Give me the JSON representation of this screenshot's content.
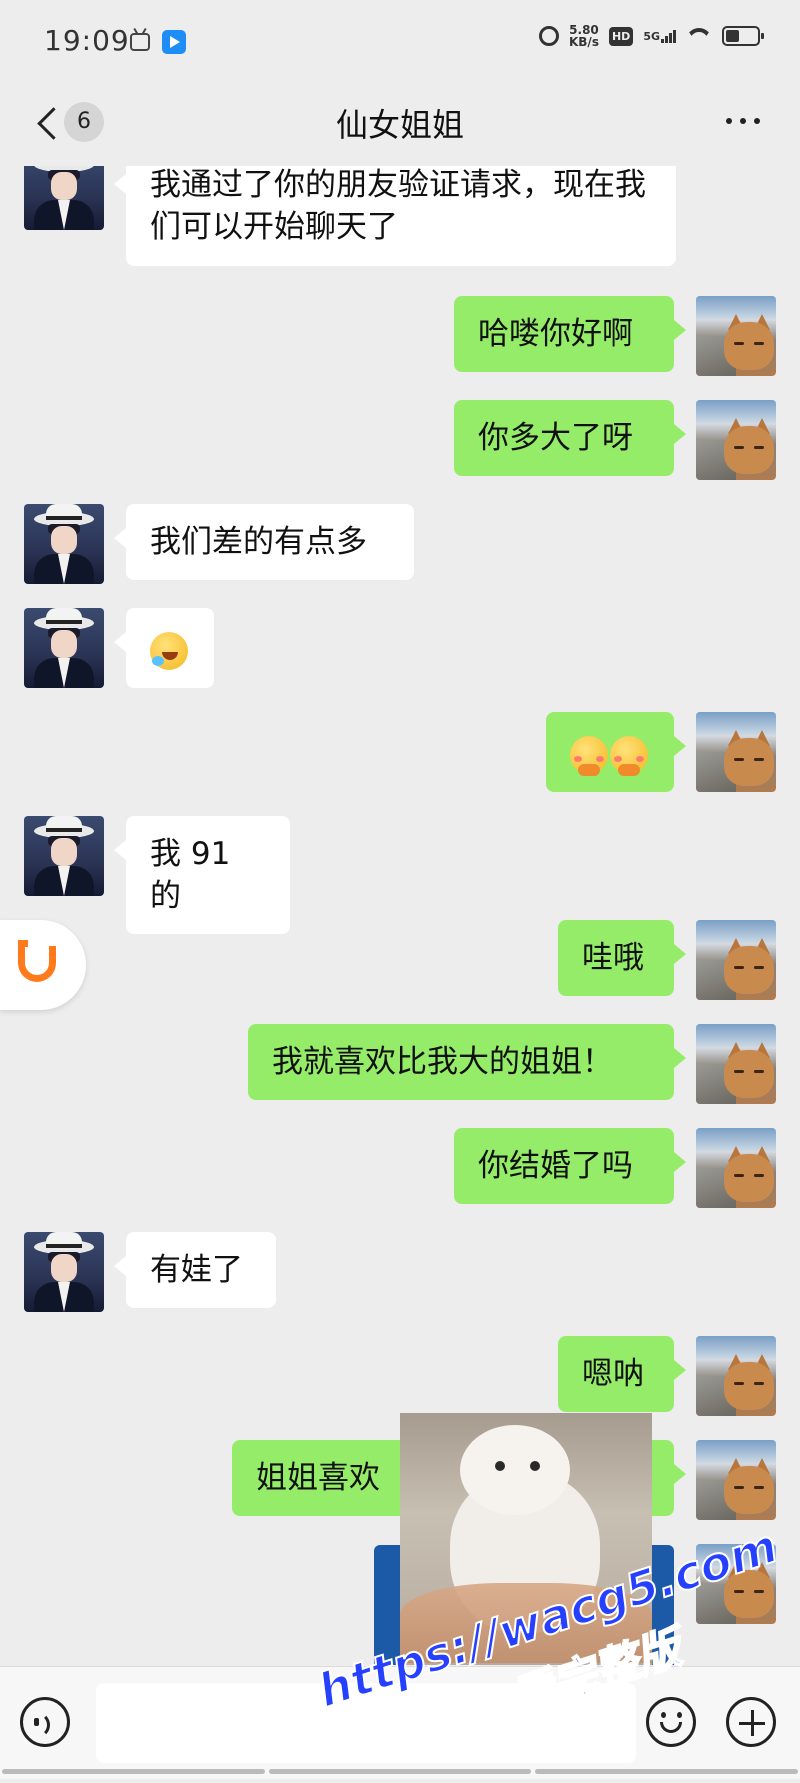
{
  "status_bar": {
    "time": "19:09",
    "speed_value": "5.80",
    "speed_unit": "KB/s",
    "hd_label": "HD",
    "network_label": "5G"
  },
  "nav": {
    "unread_count": "6",
    "title": "仙女姐姐"
  },
  "messages": [
    {
      "side": "left",
      "text": "我通过了你的朋友验证请求，现在我们可以开始聊天了"
    },
    {
      "side": "right",
      "text": "哈喽你好啊"
    },
    {
      "side": "right",
      "text": "你多大了呀"
    },
    {
      "side": "left",
      "text": "我们差的有点多"
    },
    {
      "side": "left",
      "emoji": "crying-laughing-emoji"
    },
    {
      "side": "right",
      "emoji": "blushing-emoji x2"
    },
    {
      "side": "left",
      "text": "我 91 的"
    },
    {
      "side": "right",
      "text": "哇哦"
    },
    {
      "side": "right",
      "text": "我就喜欢比我大的姐姐！"
    },
    {
      "side": "right",
      "text": "你结婚了吗"
    },
    {
      "side": "left",
      "text": "有娃了"
    },
    {
      "side": "right",
      "text": "嗯呐"
    },
    {
      "side": "right",
      "text": "姐姐喜欢"
    }
  ],
  "watermark": {
    "url": "https://wacg5.com",
    "text": "看完整版"
  },
  "colors": {
    "background": "#ededed",
    "sent_bubble": "#95ec69",
    "received_bubble": "#ffffff",
    "watermark": "#2540ff"
  }
}
